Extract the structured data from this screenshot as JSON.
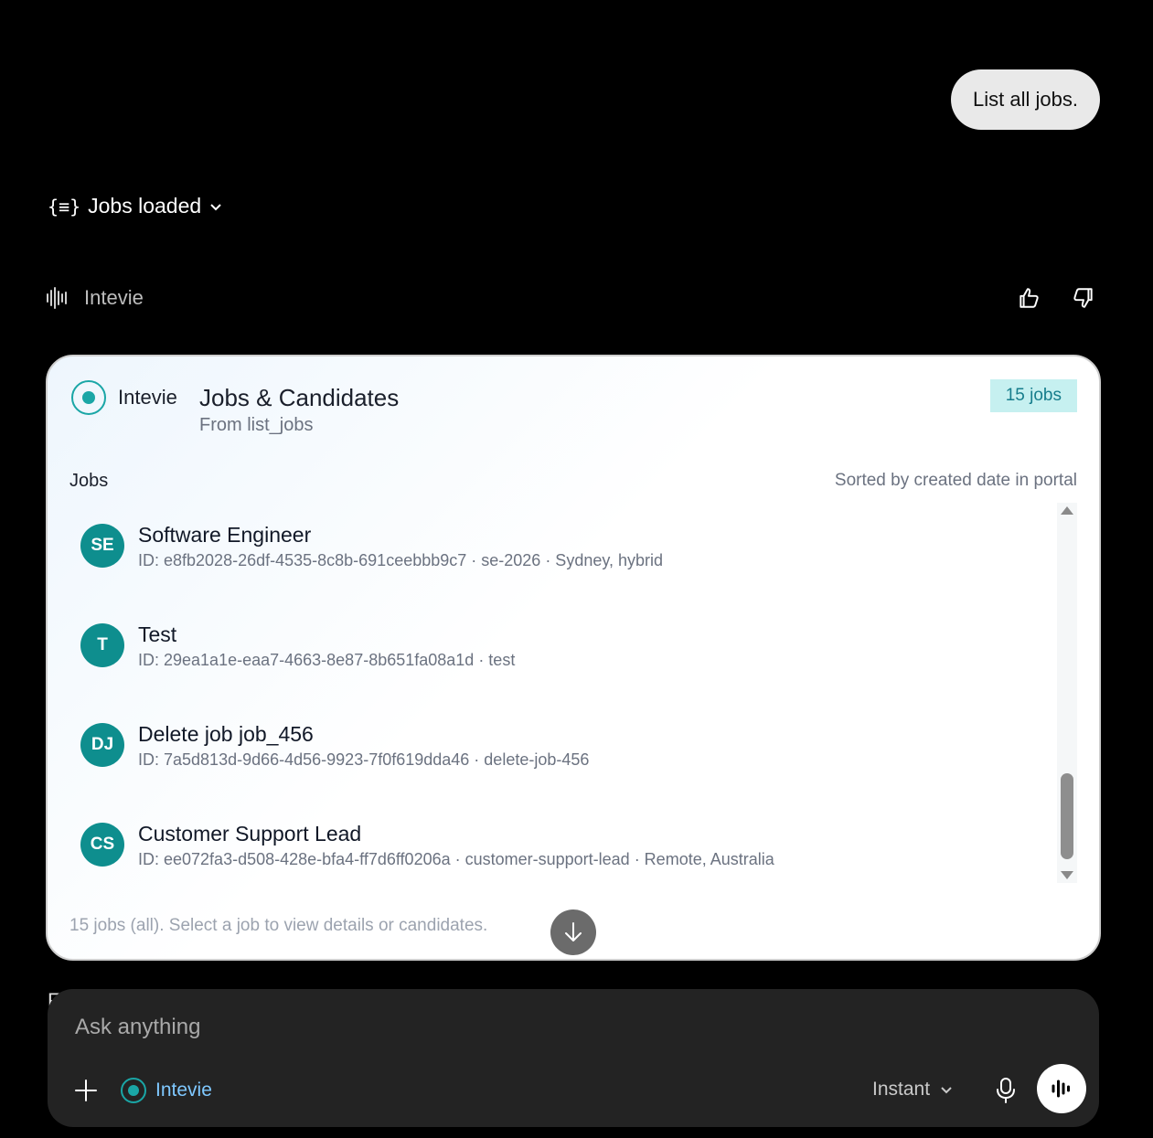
{
  "user_message": "List all jobs.",
  "tool_status": {
    "label": "Jobs loaded",
    "icon": "braces-icon"
  },
  "assistant": {
    "name": "Intevie"
  },
  "card": {
    "brand": "Intevie",
    "title": "Jobs & Candidates",
    "subtitle": "From list_jobs",
    "count_badge": "15 jobs",
    "section_label": "Jobs",
    "sort_note": "Sorted by created date in portal",
    "jobs": [
      {
        "initials": "SE",
        "title": "Software Engineer",
        "meta": "ID: e8fb2028-26df-4535-8c8b-691ceebbb9c7 · se-2026 · Sydney, hybrid"
      },
      {
        "initials": "T",
        "title": "Test",
        "meta": "ID: 29ea1a1e-eaa7-4663-8e87-8b651fa08a1d · test"
      },
      {
        "initials": "DJ",
        "title": "Delete job job_456",
        "meta": "ID: 7a5d813d-9d66-4d56-9923-7f0f619dda46 · delete-job-456"
      },
      {
        "initials": "CS",
        "title": "Customer Support Lead",
        "meta": "ID: ee072fa3-d508-428e-bfa4-ff7d6ff0206a · customer-support-lead · Remote, Australia"
      }
    ],
    "footer": "15 jobs (all). Select a job to view details or candidates."
  },
  "peek_letter": "F",
  "composer": {
    "placeholder": "Ask anything",
    "tool_chip": "Intevie",
    "mode": "Instant"
  },
  "colors": {
    "accent": "#1aa6a6",
    "avatar": "#0e8e8e",
    "badge_bg": "#c6f0f0",
    "link": "#7fc8ff"
  }
}
